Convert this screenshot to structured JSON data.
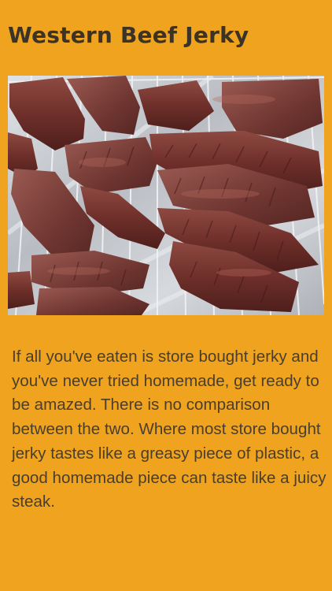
{
  "article": {
    "title": "Western Beef Jerky",
    "image": {
      "subject": "beef-jerky-on-drying-rack"
    },
    "paragraph": "If all you've eaten is store bought jerky and you've never tried homemade, get ready to be amazed. There is no comparison between the two. Where most store bought jerky tastes like a greasy piece of plastic, a good homemade piece can taste like a juicy steak."
  },
  "colors": {
    "background": "#efa31e",
    "title_text": "#3b3426",
    "body_text": "#4a3e2c",
    "foil": "#c9ccd1",
    "jerky": "#7a3a33"
  }
}
